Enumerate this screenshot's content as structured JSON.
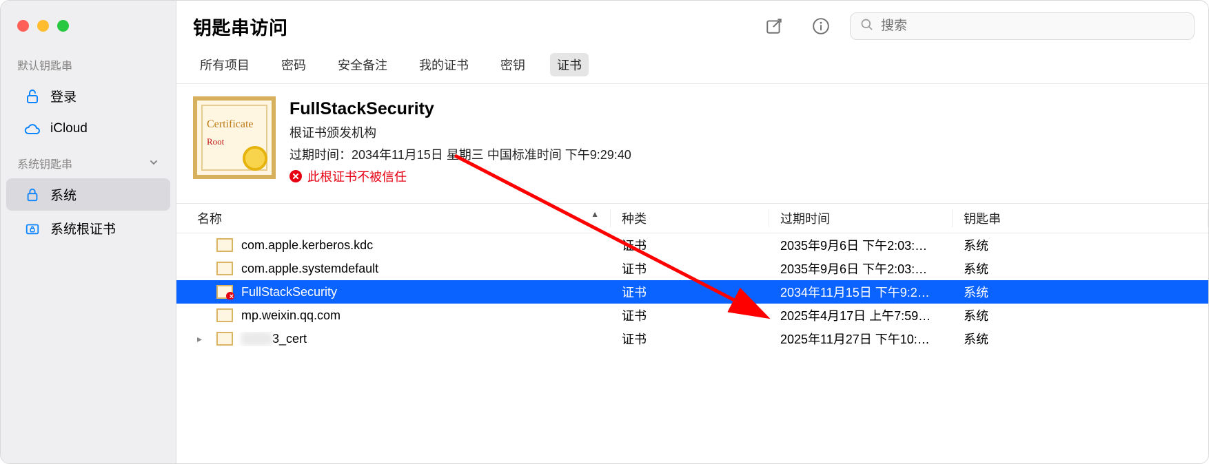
{
  "window": {
    "title": "钥匙串访问",
    "search_placeholder": "搜索"
  },
  "sidebar": {
    "section_default": "默认钥匙串",
    "section_system": "系统钥匙串",
    "items_default": [
      {
        "label": "登录",
        "icon": "unlock"
      },
      {
        "label": "iCloud",
        "icon": "cloud"
      }
    ],
    "items_system": [
      {
        "label": "系统",
        "icon": "lock",
        "selected": true
      },
      {
        "label": "系统根证书",
        "icon": "archive"
      }
    ]
  },
  "tabs": [
    {
      "label": "所有项目"
    },
    {
      "label": "密码"
    },
    {
      "label": "安全备注"
    },
    {
      "label": "我的证书"
    },
    {
      "label": "密钥"
    },
    {
      "label": "证书",
      "selected": true
    }
  ],
  "detail": {
    "name": "FullStackSecurity",
    "issuer_line": "根证书颁发机构",
    "expiry_label": "过期时间：",
    "expiry_value": "2034年11月15日 星期三 中国标准时间 下午9:29:40",
    "warning": "此根证书不被信任"
  },
  "table": {
    "columns": {
      "name": "名称",
      "kind": "种类",
      "expiry": "过期时间",
      "keychain": "钥匙串"
    },
    "rows": [
      {
        "name": "com.apple.kerberos.kdc",
        "kind": "证书",
        "expiry": "2035年9月6日 下午2:03:…",
        "keychain": "系统"
      },
      {
        "name": "com.apple.systemdefault",
        "kind": "证书",
        "expiry": "2035年9月6日 下午2:03:…",
        "keychain": "系统"
      },
      {
        "name": "FullStackSecurity",
        "kind": "证书",
        "expiry": "2034年11月15日 下午9:2…",
        "keychain": "系统",
        "selected": true,
        "bad": true
      },
      {
        "name": "mp.weixin.qq.com",
        "kind": "证书",
        "expiry": "2025年4月17日 上午7:59…",
        "keychain": "系统"
      },
      {
        "name": "3_cert",
        "kind": "证书",
        "expiry": "2025年11月27日 下午10:…",
        "keychain": "系统",
        "expandable": true,
        "blurred": true
      }
    ]
  }
}
